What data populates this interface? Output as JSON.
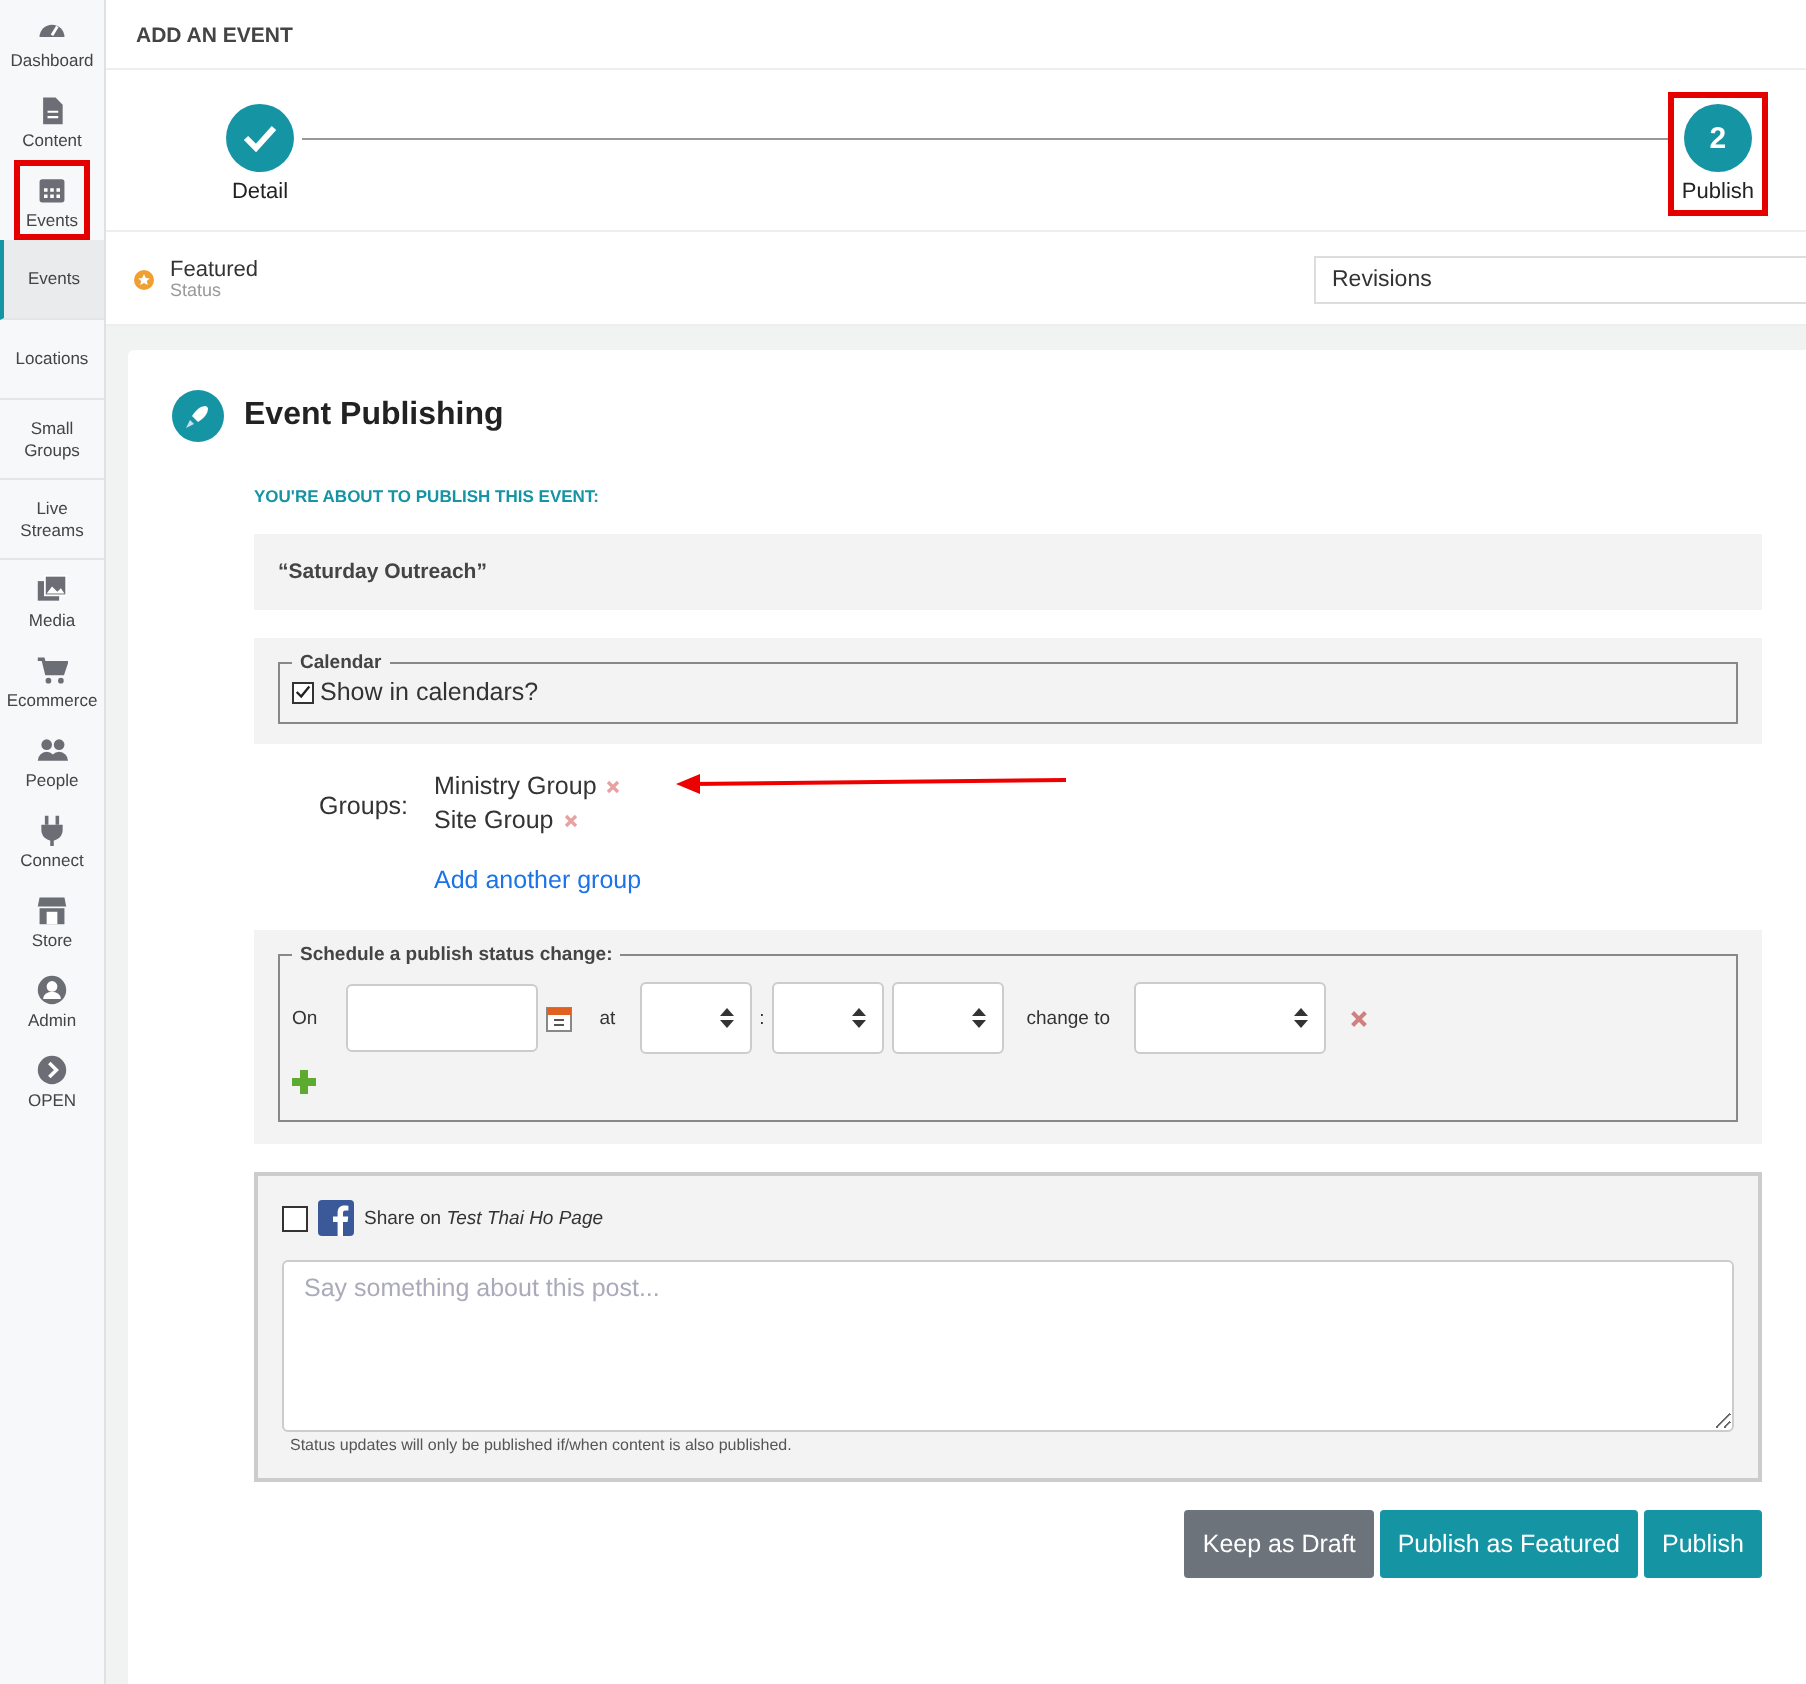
{
  "sidebar": {
    "items": [
      {
        "kind": "icon",
        "label": "Dashboard",
        "selected": false,
        "highlighted": false
      },
      {
        "kind": "icon",
        "label": "Content",
        "selected": false,
        "highlighted": false
      },
      {
        "kind": "icon",
        "label": "Events",
        "selected": false,
        "highlighted": true
      },
      {
        "kind": "sub",
        "label": "Events",
        "selected": true,
        "highlighted": false
      },
      {
        "kind": "sub",
        "label": "Locations",
        "selected": false,
        "highlighted": false
      },
      {
        "kind": "sub",
        "label": "Small Groups",
        "selected": false,
        "highlighted": false
      },
      {
        "kind": "sub",
        "label": "Live Streams",
        "selected": false,
        "highlighted": false
      },
      {
        "kind": "icon",
        "label": "Media",
        "selected": false,
        "highlighted": false
      },
      {
        "kind": "icon",
        "label": "Ecommerce",
        "selected": false,
        "highlighted": false
      },
      {
        "kind": "icon",
        "label": "People",
        "selected": false,
        "highlighted": false
      },
      {
        "kind": "icon",
        "label": "Connect",
        "selected": false,
        "highlighted": false
      },
      {
        "kind": "icon",
        "label": "Store",
        "selected": false,
        "highlighted": false
      },
      {
        "kind": "icon",
        "label": "Admin",
        "selected": false,
        "highlighted": false
      },
      {
        "kind": "icon",
        "label": "OPEN",
        "selected": false,
        "highlighted": false
      }
    ]
  },
  "page_title": "ADD AN EVENT",
  "steps": [
    {
      "label": "Detail",
      "done": true,
      "highlighted": false
    },
    {
      "label": "Publish",
      "number": "2",
      "done": false,
      "highlighted": true
    }
  ],
  "status": {
    "value": "Featured",
    "caption": "Status"
  },
  "revisions": {
    "value": "Revisions"
  },
  "card": {
    "title": "Event Publishing",
    "intro": "YOU'RE ABOUT TO PUBLISH THIS EVENT:",
    "event_name": "“Saturday Outreach”",
    "calendar": {
      "legend": "Calendar",
      "label": "Show in calendars?",
      "checked": true
    },
    "groups": {
      "label": "Groups:",
      "items": [
        {
          "name": "Ministry Group",
          "pointed": true
        },
        {
          "name": "Site Group",
          "pointed": false
        }
      ],
      "add_link": "Add another group"
    },
    "schedule": {
      "legend": "Schedule a publish status change:",
      "on": "On",
      "at": "at",
      "separator": ":",
      "change_to": "change to"
    },
    "share": {
      "checked": false,
      "label": "Share on *Test Thai Ho Page*",
      "placeholder": "Say something about this post...",
      "note": "Status updates will only be published if/when content is also published."
    },
    "buttons": [
      {
        "label": "Keep as Draft",
        "kind": "secondary"
      },
      {
        "label": "Publish as Featured",
        "kind": "primary"
      },
      {
        "label": "Publish",
        "kind": "primary"
      }
    ]
  }
}
